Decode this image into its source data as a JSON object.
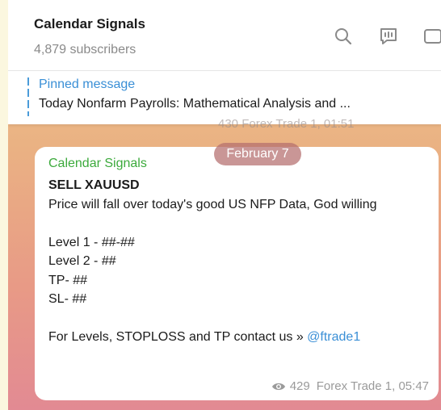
{
  "header": {
    "title": "Calendar Signals",
    "subtitle": "4,879 subscribers",
    "icons": [
      "search-icon",
      "comment-icon",
      "sidebar-icon"
    ]
  },
  "pinned": {
    "label": "Pinned message",
    "text": "Today Nonfarm Payrolls: Mathematical Analysis and ..."
  },
  "previous_message": {
    "meta": "430 Forex Trade 1, 01:51"
  },
  "date_separator": "February 7",
  "message": {
    "sender": "Calendar Signals",
    "title": "SELL XAUUSD",
    "line1": "Price will fall over today's good US NFP Data, God willing",
    "level1": "Level 1 - ##-##",
    "level2": "Level 2 - ##",
    "tp": "TP- ##",
    "sl": "SL- ##",
    "contact_text": "For Levels, STOPLOSS and TP contact us » ",
    "contact_link": "@ftrade1",
    "views": "429",
    "author_time": "Forex Trade 1, 05:47"
  },
  "colors": {
    "accent_blue": "#3a8fd6",
    "sender_green": "#3caa3c"
  }
}
